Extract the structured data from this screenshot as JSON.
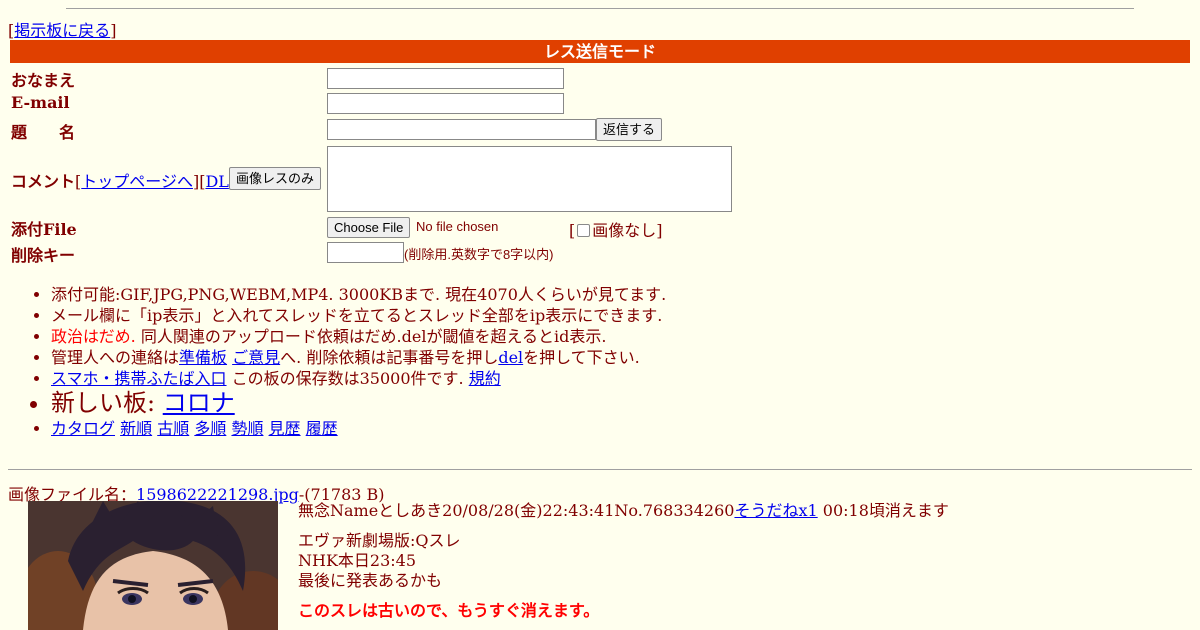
{
  "nav": {
    "back_prefix": "[",
    "back_link": "掲示板に戻る",
    "back_suffix": "]"
  },
  "form": {
    "mode_title": "レス送信モード",
    "name_label": "おなまえ",
    "email_label": "E-mail",
    "subject_label": "題　　名",
    "submit_label": "返信する",
    "comment_label": "コメント",
    "comment_links": {
      "open1": "[",
      "top_link": "トップページへ",
      "mid": "][",
      "dl_link": "DL",
      "close": "]"
    },
    "image_only_button": "画像レスのみ",
    "file_label": "添付File",
    "choose_file_button": "Choose File",
    "no_file_text": "No file chosen",
    "no_image_prefix": "[",
    "no_image_label": "画像なし",
    "no_image_suffix": "]",
    "delete_key_label": "削除キー",
    "delete_key_note": "(削除用.英数字で8字以内)"
  },
  "info": {
    "line1": "添付可能:GIF,JPG,PNG,WEBM,MP4. 3000KBまで. 現在4070人くらいが見てます.",
    "line2": "メール欄に「ip表示」と入れてスレッドを立てるとスレッド全部をip表示にできます.",
    "line3_red": "政治はだめ.",
    "line3_rest": " 同人関連のアップロード依頼はだめ.delが閾値を超えるとid表示.",
    "line4_a": "管理人への連絡は",
    "line4_link1": "準備板",
    "line4_link2": "ご意見",
    "line4_b": "へ. 削除依頼は記事番号を押し",
    "line4_link3": "del",
    "line4_c": "を押して下さい.",
    "line5_link": "スマホ・携帯ふたば入口",
    "line5_text": " この板の保存数は35000件です. ",
    "line5_link2": "規約",
    "line6_text": "新しい板: ",
    "line6_link": "コロナ",
    "line7_links": [
      "カタログ",
      "新順",
      "古順",
      "多順",
      "勢順",
      "見歴",
      "履歴"
    ]
  },
  "thread": {
    "file_prefix": "画像ファイル名：",
    "file_name": "1598622221298.jpg",
    "file_size": "-(71783 B)",
    "header_text": "無念Nameとしあき20/08/28(金)22:43:41No.768334260",
    "soudane": "そうだねx1",
    "expire": " 00:18頃消えます",
    "body": [
      "エヴァ新劇場版:Qスレ",
      "NHK本日23:45",
      "最後に発表あるかも"
    ],
    "warning": "このスレは古いので、もうすぐ消えます。"
  },
  "colors": {
    "background": "#ffffee",
    "text": "#800000",
    "mode_bar": "#e04000",
    "link": "#0000ee",
    "warning": "#ff0000"
  }
}
